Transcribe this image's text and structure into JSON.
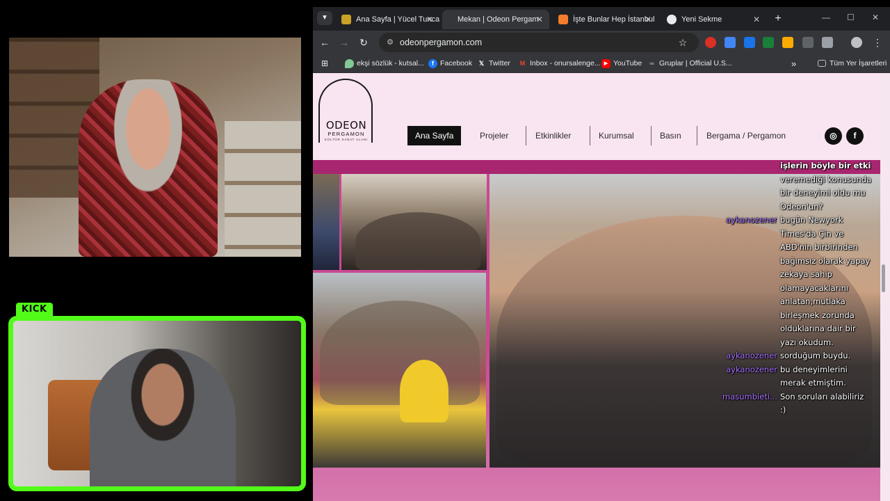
{
  "browser": {
    "tabs": [
      {
        "label": "Ana Sayfa | Yücel Tunca",
        "active": false,
        "favicon_color": "#c9a227"
      },
      {
        "label": "Mekan | Odeon Pergam",
        "active": true,
        "favicon_color": "#35363a"
      },
      {
        "label": "İşte Bunlar Hep İstanbul",
        "active": false,
        "favicon_color": "#f57c2b"
      },
      {
        "label": "Yeni Sekme",
        "active": false,
        "favicon_color": "#8ab4f8"
      }
    ],
    "url": "odeonpergamon.com",
    "bookmarks": [
      {
        "label": "ekşi sözlük - kutsal...",
        "icon": "leaf-icon",
        "color": "#81c995"
      },
      {
        "label": "Facebook",
        "icon": "facebook-icon",
        "color": "#1877f2"
      },
      {
        "label": "Twitter",
        "icon": "x-icon",
        "color": "#000000"
      },
      {
        "label": "Inbox - onursalenge...",
        "icon": "gmail-icon",
        "color": "#ea4335"
      },
      {
        "label": "YouTube",
        "icon": "youtube-icon",
        "color": "#ff0000"
      },
      {
        "label": "Gruplar | Official U.S...",
        "icon": "link-icon",
        "color": "#9aa0a6"
      }
    ],
    "bookmarks_more": "»",
    "all_bookmarks": "Tüm Yer İşaretleri"
  },
  "site": {
    "logo": {
      "word": "ODEON",
      "sub": "PERGAMON",
      "tag": "KÜLTÜR SANAT ALANI"
    },
    "nav": [
      "Ana Sayfa",
      "Projeler",
      "Etkinlikler",
      "Kurumsal",
      "Basın",
      "Bergama / Pergamon"
    ],
    "social": [
      "instagram-icon",
      "facebook-icon"
    ]
  },
  "overlay": {
    "platform_tag": "KICK",
    "accent": "#53fc18"
  },
  "chat": [
    {
      "user": "",
      "text": "işlerin böyle bir etki",
      "bold": true
    },
    {
      "user": "",
      "text": "veremediği konusunda",
      "bold": false
    },
    {
      "user": "",
      "text": "bir deneyimi oldu mu",
      "bold": false
    },
    {
      "user": "",
      "text": "Odeon'un?",
      "bold": false
    },
    {
      "user": "aykanozener",
      "text": "bugün Newyork",
      "bold": false
    },
    {
      "user": "",
      "text": "Times'da Çin ve",
      "bold": false
    },
    {
      "user": "",
      "text": "ABD'nin birbirinden",
      "bold": false
    },
    {
      "user": "",
      "text": "bağımsız olarak yapay",
      "bold": false
    },
    {
      "user": "",
      "text": "zekaya sahip",
      "bold": false
    },
    {
      "user": "",
      "text": "olamayacaklarını",
      "bold": false
    },
    {
      "user": "",
      "text": "anlatan,mutlaka",
      "bold": false
    },
    {
      "user": "",
      "text": "birleşmek zorunda",
      "bold": false
    },
    {
      "user": "",
      "text": "olduklarına dair bir",
      "bold": false
    },
    {
      "user": "",
      "text": "yazı okudum.",
      "bold": false
    },
    {
      "user": "aykanozener",
      "text": "sorduğum buydu.",
      "bold": false
    },
    {
      "user": "aykanozener",
      "text": "bu deneyimlerini",
      "bold": false
    },
    {
      "user": "",
      "text": "merak etmiştim.",
      "bold": false
    },
    {
      "user": "masumbieti...",
      "text": "Son soruları alabiliriz",
      "bold": false
    },
    {
      "user": "",
      "text": ":)",
      "bold": false
    }
  ]
}
